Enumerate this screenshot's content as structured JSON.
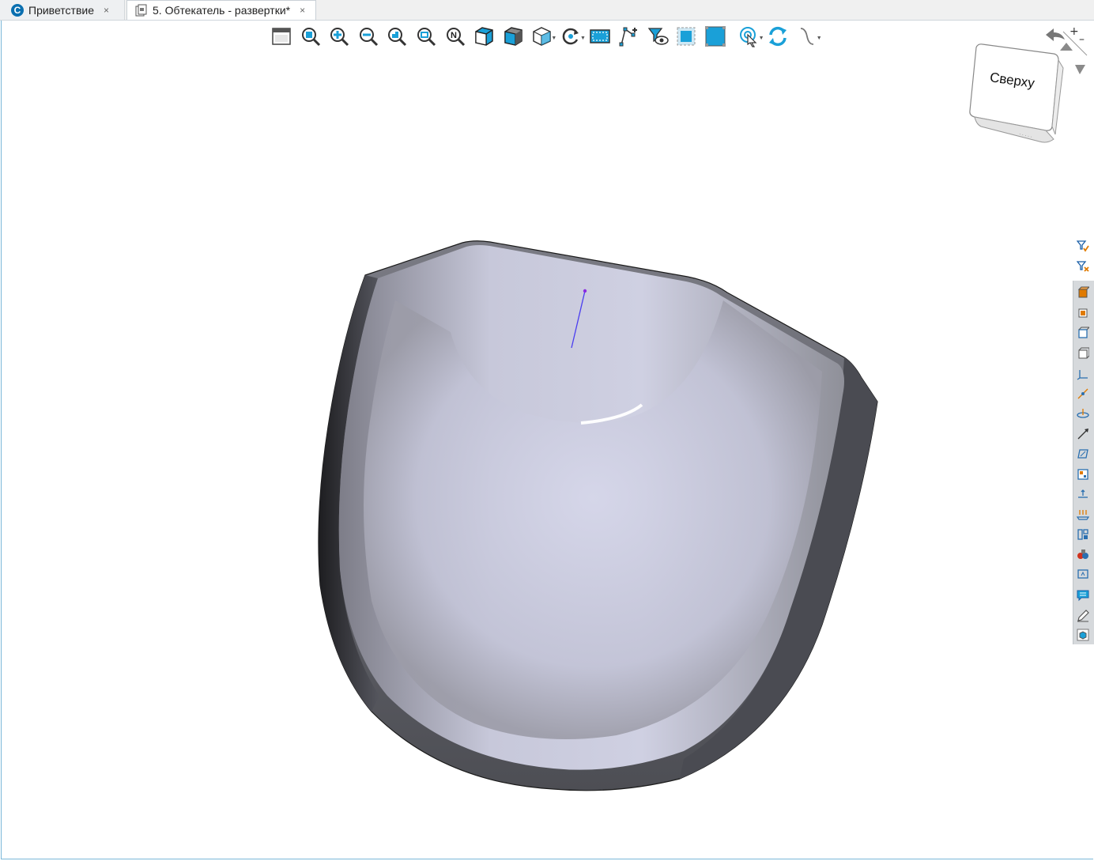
{
  "tabs": [
    {
      "label": "Приветствие",
      "close": "×"
    },
    {
      "label": "5. Обтекатель - развертки*",
      "close": "×"
    }
  ],
  "app_logo_letter": "C",
  "view_cube": {
    "face_label": "Сверху"
  },
  "toolbar": {
    "items": [
      {
        "icon": "window-icon"
      },
      {
        "icon": "zoom-window-icon"
      },
      {
        "icon": "zoom-in-icon"
      },
      {
        "icon": "zoom-out-icon"
      },
      {
        "icon": "zoom-previous-icon"
      },
      {
        "icon": "zoom-to-fit-icon"
      },
      {
        "icon": "normal-view-icon",
        "letter": "N"
      },
      {
        "icon": "shaded-cube-icon"
      },
      {
        "icon": "shaded-edges-cube-icon"
      },
      {
        "icon": "wireframe-cube-icon"
      },
      {
        "icon": "rotate-view-icon"
      },
      {
        "icon": "select-frame-icon"
      },
      {
        "icon": "show-points-icon"
      },
      {
        "icon": "visibility-filter-icon"
      },
      {
        "icon": "section-view-icon"
      },
      {
        "icon": "full-view-icon"
      },
      {
        "icon": "cursor-target-icon"
      },
      {
        "icon": "refresh-icon"
      },
      {
        "icon": "curve-icon"
      }
    ]
  },
  "colors": {
    "accent": "#1aa0d8",
    "frame": "#7ab7d8",
    "part_light": "#d3d5e6",
    "part_dark": "#3e3f44",
    "sketch_line": "#4a3df0"
  }
}
